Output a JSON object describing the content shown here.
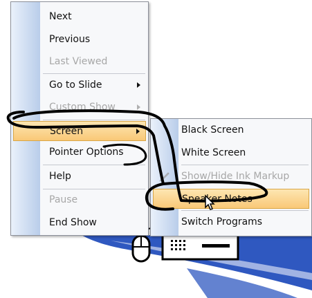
{
  "main_menu": {
    "items": [
      {
        "id": "next",
        "label": "Next",
        "enabled": true
      },
      {
        "id": "previous",
        "label": "Previous",
        "enabled": true
      },
      {
        "id": "last-viewed",
        "label": "Last Viewed",
        "enabled": false
      },
      {
        "id": "go-to-slide",
        "label": "Go to Slide",
        "enabled": true,
        "submenu": true
      },
      {
        "id": "custom-show",
        "label": "Custom Show",
        "enabled": false,
        "submenu": true
      },
      {
        "id": "screen",
        "label": "Screen",
        "enabled": true,
        "submenu": true,
        "highlighted": true
      },
      {
        "id": "pointer-options",
        "label": "Pointer Options",
        "enabled": true
      },
      {
        "id": "help",
        "label": "Help",
        "enabled": true
      },
      {
        "id": "pause",
        "label": "Pause",
        "enabled": false
      },
      {
        "id": "end-show",
        "label": "End Show",
        "enabled": true
      }
    ]
  },
  "screen_submenu": {
    "items": [
      {
        "id": "black-screen",
        "label": "Black Screen",
        "enabled": true
      },
      {
        "id": "white-screen",
        "label": "White Screen",
        "enabled": true
      },
      {
        "id": "show-hide-ink-markup",
        "label": "Show/Hide Ink Markup",
        "enabled": false,
        "icon": "ink-pen-icon"
      },
      {
        "id": "speaker-notes",
        "label": "Speaker Notes",
        "enabled": true,
        "highlighted": true
      },
      {
        "id": "switch-programs",
        "label": "Switch Programs",
        "enabled": true
      }
    ]
  },
  "colors": {
    "highlight_fill": "#f9c877",
    "highlight_border": "#d9a646",
    "gutter": "#b9cdea",
    "disabled_text": "#a7a7a7",
    "background_swoosh": "#2f58c0",
    "annotation_ink": "#000000"
  },
  "icons": [
    "mouse-icon",
    "keyboard-icon",
    "ink-pen-icon",
    "mouse-cursor-icon"
  ]
}
